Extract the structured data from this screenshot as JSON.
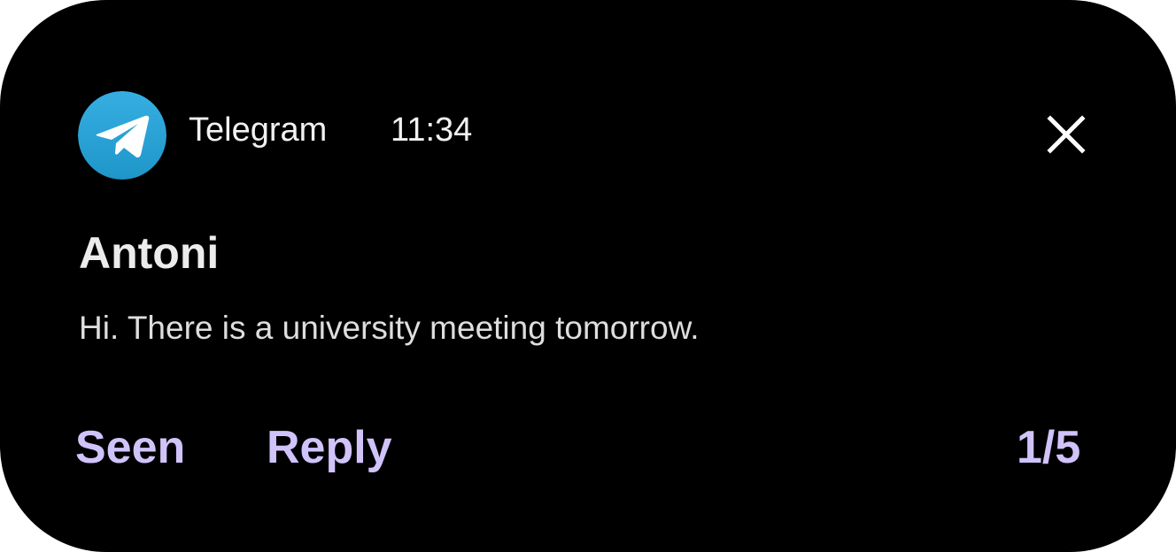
{
  "notification": {
    "app_name": "Telegram",
    "time": "11:34",
    "app_icon": "telegram-icon",
    "close_icon": "close-icon",
    "sender": "Antoni",
    "message": "Hi. There is a university meeting tomorrow.",
    "actions": {
      "seen_label": "Seen",
      "reply_label": "Reply"
    },
    "counter": "1/5"
  },
  "colors": {
    "background": "#000000",
    "accent": "#d0c3fa",
    "icon_gradient_top": "#37aee2",
    "icon_gradient_bottom": "#1e96c8"
  }
}
